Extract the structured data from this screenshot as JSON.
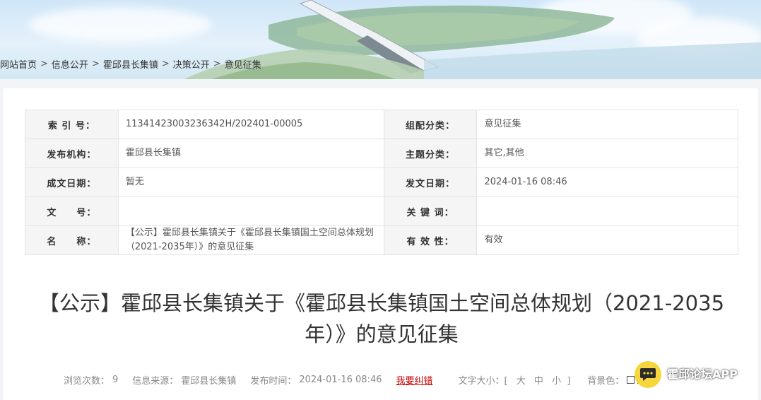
{
  "breadcrumb": [
    "网站首页",
    "信息公开",
    "霍邱县长集镇",
    "决策公开",
    "意见征集"
  ],
  "breadcrumb_separator": ">",
  "meta": {
    "row1": {
      "l1": "索 引 号：",
      "v1": "11341423003236342H/202401-00005",
      "l2": "组配分类：",
      "v2": "意见征集"
    },
    "row2": {
      "l1": "发布机构：",
      "v1": "霍邱县长集镇",
      "l2": "主题分类：",
      "v2": "其它,其他"
    },
    "row3": {
      "l1": "成文日期：",
      "v1": "暂无",
      "l2": "发文日期：",
      "v2": "2024-01-16 08:46"
    },
    "row4": {
      "l1": "文　　号：",
      "v1": "",
      "l2": "关 键 词：",
      "v2": ""
    },
    "row5": {
      "l1": "名　　称：",
      "v1": "【公示】霍邱县长集镇关于《霍邱县长集镇国土空间总体规划（2021-2035年）》的意见征集",
      "l2": "有 效 性：",
      "v2": "有效"
    }
  },
  "title": "【公示】霍邱县长集镇关于《霍邱县长集镇国土空间总体规划（2021-2035年）》的意见征集",
  "infobar": {
    "views_label": "浏览次数：",
    "views": "9",
    "source_label": "信息来源：",
    "source": "霍邱县长集镇",
    "time_label": "发布时间：",
    "time": "2024-01-16 08:46",
    "report": "我要纠错",
    "fontsize_label": "文字大小：[",
    "fs_large": "大",
    "fs_mid": "中",
    "fs_small": "小",
    "fontsize_end": "]",
    "bg_label": "背景色："
  },
  "colors": {
    "accent_red": "#cc0000",
    "label_bg": "#f5f5f5",
    "border": "#e3e3e3",
    "watermark_yellow": "#f6d63a"
  },
  "watermark": {
    "name": "霍邱论坛APP"
  }
}
